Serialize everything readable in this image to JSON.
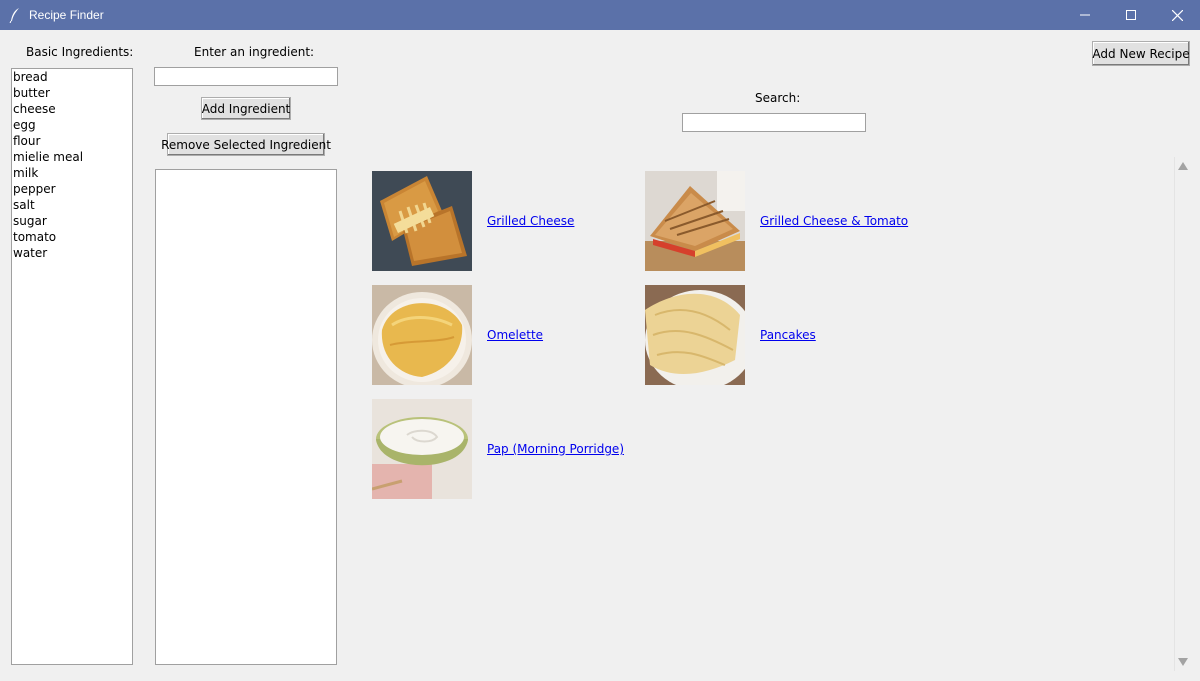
{
  "window": {
    "title": "Recipe Finder"
  },
  "left": {
    "basic_label": "Basic Ingredients:",
    "basic_items": [
      "bread",
      "butter",
      "cheese",
      "egg",
      "flour",
      "mielie meal",
      "milk",
      "pepper",
      "salt",
      "sugar",
      "tomato",
      "water"
    ]
  },
  "middle": {
    "enter_label": "Enter an ingredient:",
    "ingredient_value": "",
    "add_button": "Add Ingredient",
    "remove_button": "Remove Selected Ingredient"
  },
  "right": {
    "add_recipe_button": "Add New Recipe",
    "search_label": "Search:",
    "search_value": "",
    "recipes": [
      {
        "name": "Grilled Cheese",
        "image": "grilled-cheese"
      },
      {
        "name": "Grilled Cheese & Tomato",
        "image": "grilled-cheese-tomato"
      },
      {
        "name": "Omelette",
        "image": "omelette"
      },
      {
        "name": "Pancakes",
        "image": "pancakes"
      },
      {
        "name": "Pap (Morning Porridge)",
        "image": "pap-porridge"
      }
    ]
  },
  "icons": {
    "app": "feather-icon",
    "minimize": "minimize-icon",
    "maximize": "maximize-icon",
    "close": "close-icon",
    "scroll_up": "scroll-up-arrow-icon",
    "scroll_down": "scroll-down-arrow-icon"
  },
  "colors": {
    "titlebar": "#5b71a9",
    "link": "#0000ee",
    "window_bg": "#f0f0f0"
  }
}
